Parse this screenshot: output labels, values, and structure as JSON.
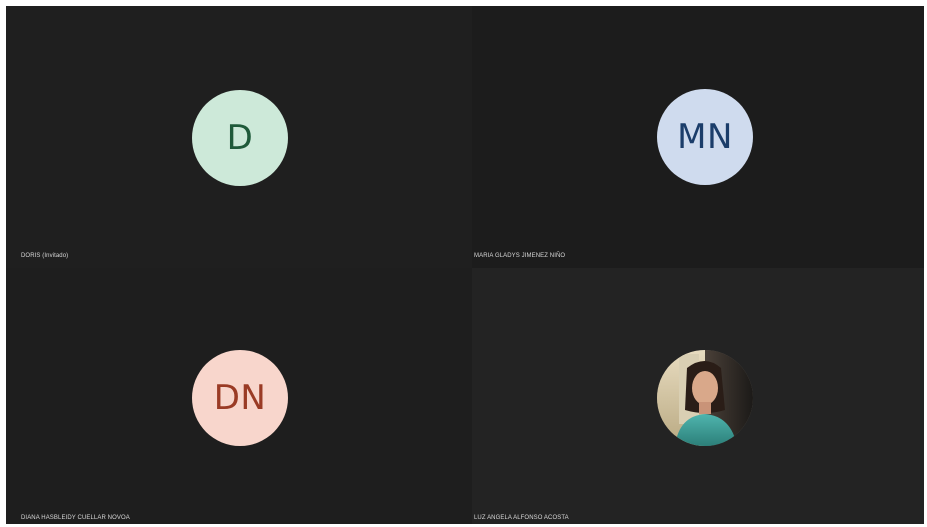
{
  "participants": [
    {
      "name": "DORIS (Invitado)",
      "initials": "D",
      "avatar_bg": "#cde9d9",
      "avatar_fg": "#1f5a3a"
    },
    {
      "name": "MARIA GLADYS JIMENEZ NIÑO",
      "initials": "MN",
      "avatar_bg": "#cfdbee",
      "avatar_fg": "#1b3d6a"
    },
    {
      "name": "DIANA HASBLEIDY CUELLAR NOVOA",
      "initials": "DN",
      "avatar_bg": "#f8d6cc",
      "avatar_fg": "#9a3b25"
    },
    {
      "name": "LUZ ANGELA ALFONSO ACOSTA",
      "avatar_type": "photo"
    }
  ]
}
